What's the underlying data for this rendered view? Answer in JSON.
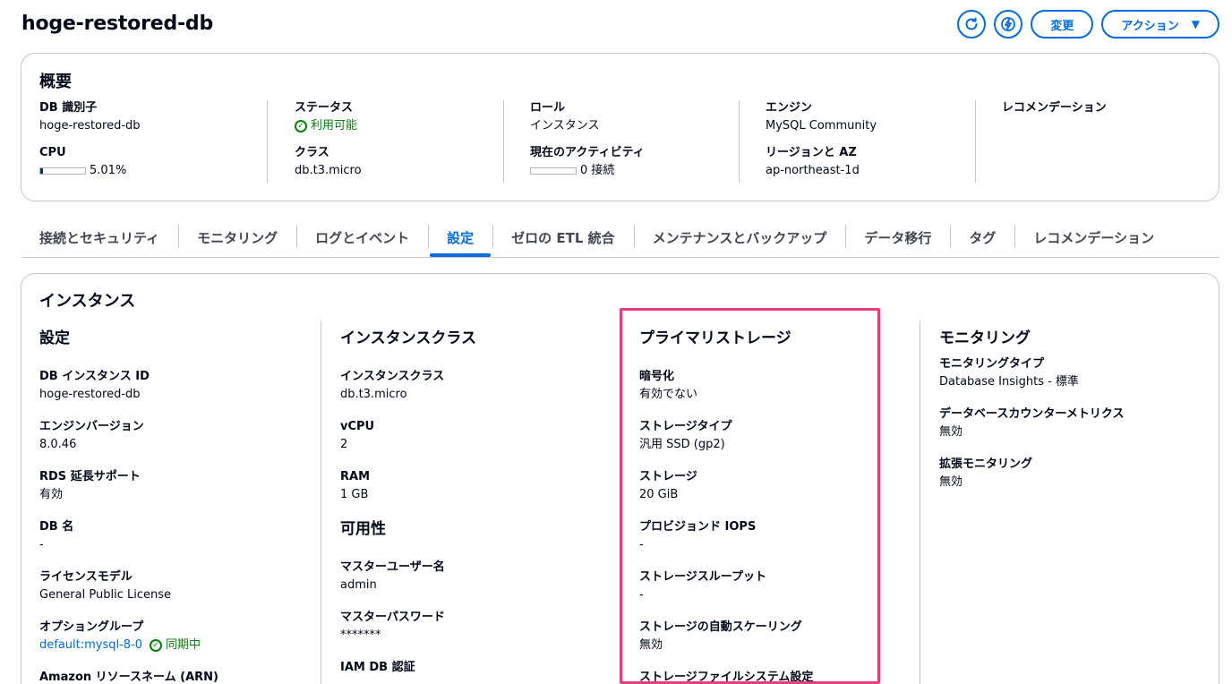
{
  "page": {
    "title": "hoge-restored-db"
  },
  "header": {
    "modify_label": "変更",
    "actions_label": "アクション",
    "refresh_icon": "refresh-icon",
    "insights_icon": "lightning-icon"
  },
  "summary": {
    "heading": "概要",
    "db_identifier": {
      "label": "DB 識別子",
      "value": "hoge-restored-db"
    },
    "cpu": {
      "label": "CPU",
      "value": "5.01%",
      "fraction": 0.0501
    },
    "status": {
      "label": "ステータス",
      "value": "利用可能"
    },
    "class": {
      "label": "クラス",
      "value": "db.t3.micro"
    },
    "role": {
      "label": "ロール",
      "value": "インスタンス"
    },
    "activity": {
      "label": "現在のアクティビティ",
      "value": "0 接続",
      "fraction": 0
    },
    "engine": {
      "label": "エンジン",
      "value": "MySQL Community"
    },
    "region": {
      "label": "リージョンと AZ",
      "value": "ap-northeast-1d"
    },
    "recommendations": {
      "label": "レコメンデーション"
    }
  },
  "tabs": [
    {
      "label": "接続とセキュリティ"
    },
    {
      "label": "モニタリング"
    },
    {
      "label": "ログとイベント"
    },
    {
      "label": "設定"
    },
    {
      "label": "ゼロの ETL 統合"
    },
    {
      "label": "メンテナンスとバックアップ"
    },
    {
      "label": "データ移行"
    },
    {
      "label": "タグ"
    },
    {
      "label": "レコメンデーション"
    }
  ],
  "active_tab": "設定",
  "instance": {
    "heading": "インスタンス",
    "config": {
      "title": "設定",
      "items": [
        {
          "label": "DB インスタンス ID",
          "value": "hoge-restored-db"
        },
        {
          "label": "エンジンバージョン",
          "value": "8.0.46"
        },
        {
          "label": "RDS 延長サポート",
          "value": "有効"
        },
        {
          "label": "DB 名",
          "value": "-"
        },
        {
          "label": "ライセンスモデル",
          "value": "General Public License"
        },
        {
          "label": "オプショングループ",
          "value": "default:mysql-8-0",
          "status": "同期中"
        },
        {
          "label": "Amazon リソースネーム (ARN)"
        }
      ]
    },
    "instance_class": {
      "title": "インスタンスクラス",
      "items": [
        {
          "label": "インスタンスクラス",
          "value": "db.t3.micro"
        },
        {
          "label": "vCPU",
          "value": "2"
        },
        {
          "label": "RAM",
          "value": "1 GB"
        }
      ]
    },
    "availability": {
      "title": "可用性",
      "items": [
        {
          "label": "マスターユーザー名",
          "value": "admin"
        },
        {
          "label": "マスターパスワード",
          "value": "*******"
        },
        {
          "label": "IAM DB 認証"
        }
      ]
    },
    "storage": {
      "title": "プライマリストレージ",
      "items": [
        {
          "label": "暗号化",
          "value": "有効でない"
        },
        {
          "label": "ストレージタイプ",
          "value": "汎用 SSD (gp2)"
        },
        {
          "label": "ストレージ",
          "value": "20 GiB"
        },
        {
          "label": "プロビジョンド IOPS",
          "value": "-"
        },
        {
          "label": "ストレージスループット",
          "value": "-"
        },
        {
          "label": "ストレージの自動スケーリング",
          "value": "無効"
        },
        {
          "label": "ストレージファイルシステム設定"
        }
      ]
    },
    "monitoring": {
      "title": "モニタリング",
      "items": [
        {
          "label": "モニタリングタイプ",
          "value": "Database Insights - 標準"
        },
        {
          "label": "データベースカウンターメトリクス",
          "value": "無効"
        },
        {
          "label": "拡張モニタリング",
          "value": "無効"
        }
      ]
    }
  },
  "colors": {
    "accent": "#006ce0",
    "success": "#037f0c",
    "highlight": "#e73c7e"
  }
}
